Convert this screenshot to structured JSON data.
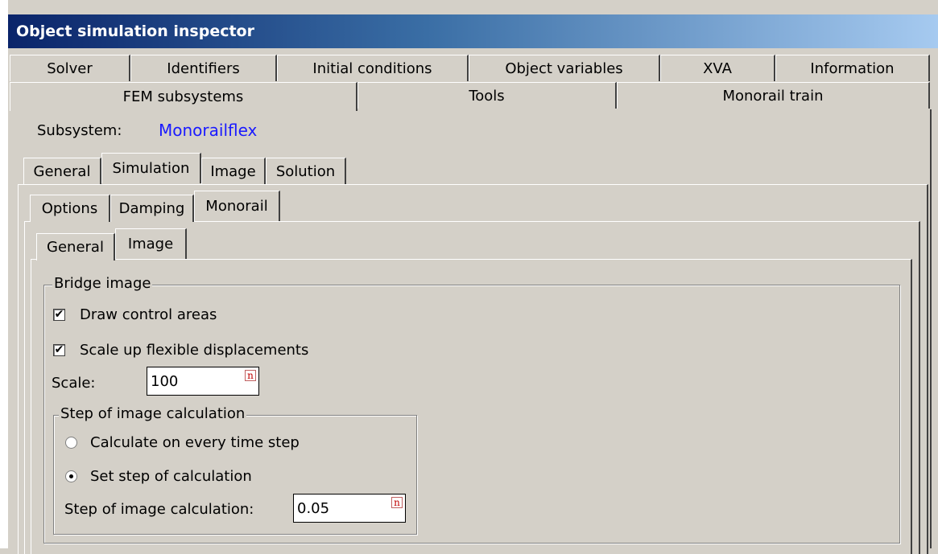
{
  "window": {
    "title": "Object simulation inspector"
  },
  "tabs_row1": [
    "Solver",
    "Identifiers",
    "Initial conditions",
    "Object variables",
    "XVA",
    "Information"
  ],
  "tabs_row2": [
    "FEM subsystems",
    "Tools",
    "Monorail train"
  ],
  "subsystem": {
    "label": "Subsystem:",
    "value": "Monorailflex"
  },
  "subtabs1": [
    "General",
    "Simulation",
    "Image",
    "Solution"
  ],
  "subtabs2": [
    "Options",
    "Damping",
    "Monorail"
  ],
  "subtabs3": [
    "General",
    "Image"
  ],
  "bridge_image": {
    "legend": "Bridge image",
    "draw_control_areas": {
      "label": "Draw control areas",
      "checked": true
    },
    "scale_up": {
      "label": "Scale up flexible displacements",
      "checked": true
    },
    "scale_label": "Scale:",
    "scale_value": "100"
  },
  "step_group": {
    "legend": "Step of image calculation",
    "option_every": "Calculate on every time step",
    "option_set": "Set step of calculation",
    "selected": "Set step of calculation",
    "step_label": "Step of image calculation:",
    "step_value": "0.05"
  },
  "field_icon": "n"
}
